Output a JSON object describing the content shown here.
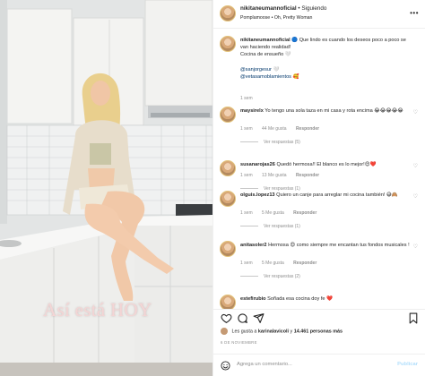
{
  "media": {
    "overlay_text": "Así está HOY"
  },
  "header": {
    "username": "nikitaneumannoficial",
    "separator": "•",
    "follow_status": "Siguiendo",
    "audio": "Pomplamoose • Oh, Pretty Woman"
  },
  "caption": {
    "username": "nikitaneumannoficial",
    "text": "🔵 Que lindo es cuando los deseos poco a poco se van haciendo realidad!",
    "text2": "Cocina de ensueño 🤍",
    "mention1": "@sanjorgesur 🤍",
    "mention2": "@vetasamoblamientos 🥰",
    "time": "1 sem"
  },
  "comments": [
    {
      "username": "maysirelx",
      "text": "Yo tengo una sola taza en mi casa y rota encima 😂😂😂😂😂",
      "time": "1 sem",
      "likes": "44 Me gusta",
      "reply": "Responder",
      "view_replies": "Ver respuestas (5)"
    },
    {
      "username": "susanarojas26",
      "text": "Quedó hermosa!! El blanco es lo mejor!😍❤️",
      "time": "1 sem",
      "likes": "13 Me gusta",
      "reply": "Responder",
      "view_replies": "Ver respuestas (1)"
    },
    {
      "username": "olguis.lopez13",
      "text": "Quiero un canje para arreglar mi cocina también! 😅🙈",
      "time": "1 sem",
      "likes": "5 Me gusta",
      "reply": "Responder",
      "view_replies": "Ver respuestas (1)"
    },
    {
      "username": "anitasoler2",
      "text": "Hermosa 😍 como siempre me encantan tus fondos musicales !",
      "time": "1 sem",
      "likes": "5 Me gusta",
      "reply": "Responder",
      "view_replies": "Ver respuestas (2)"
    },
    {
      "username": "estefirubio",
      "text": "Soñada esa cocina doy fe ❤️",
      "time": "",
      "likes": "",
      "reply": "",
      "view_replies": ""
    }
  ],
  "likes": {
    "prefix": "Les gusta a",
    "user": "karinalavicoli",
    "connector": "y",
    "count": "14.461 personas más"
  },
  "date": "6 DE NOVIEMBRE",
  "add_comment": {
    "placeholder": "Agrega un comentario...",
    "publish": "Publicar"
  },
  "colors": {
    "link": "#00376b",
    "muted": "#8e8e8e",
    "publish_disabled": "#b2dffc",
    "heart_red": "#ed4956"
  }
}
